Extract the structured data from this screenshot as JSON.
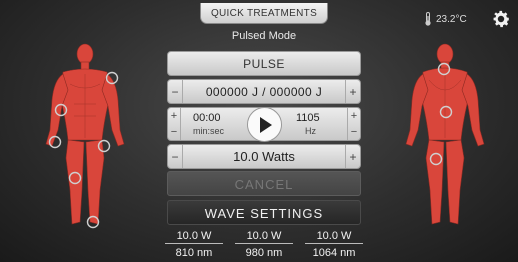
{
  "header": {
    "quick_treatments_label": "QUICK TREATMENTS",
    "mode_label": "Pulsed Mode",
    "temperature": "23.2°C"
  },
  "panel": {
    "pulse_label": "PULSE",
    "energy_value": "000000 J / 000000 J",
    "time_value": "00:00",
    "time_unit": "min:sec",
    "frequency_value": "1105",
    "frequency_unit": "Hz",
    "power_value": "10.0 Watts",
    "cancel_label": "CANCEL",
    "wave_settings_label": "WAVE SETTINGS",
    "plus_symbol": "+",
    "minus_symbol": "−"
  },
  "lasers": [
    {
      "power": "10.0 W",
      "wavelength": "810 nm"
    },
    {
      "power": "10.0 W",
      "wavelength": "980 nm"
    },
    {
      "power": "10.0 W",
      "wavelength": "1064 nm"
    }
  ],
  "icons": {
    "thermometer": "thermometer-icon",
    "settings": "gear-icon",
    "play": "play-icon"
  },
  "colors": {
    "muscle": "#d9463b",
    "background": "#2e2e2e",
    "button_light": "#e0e0e0"
  }
}
